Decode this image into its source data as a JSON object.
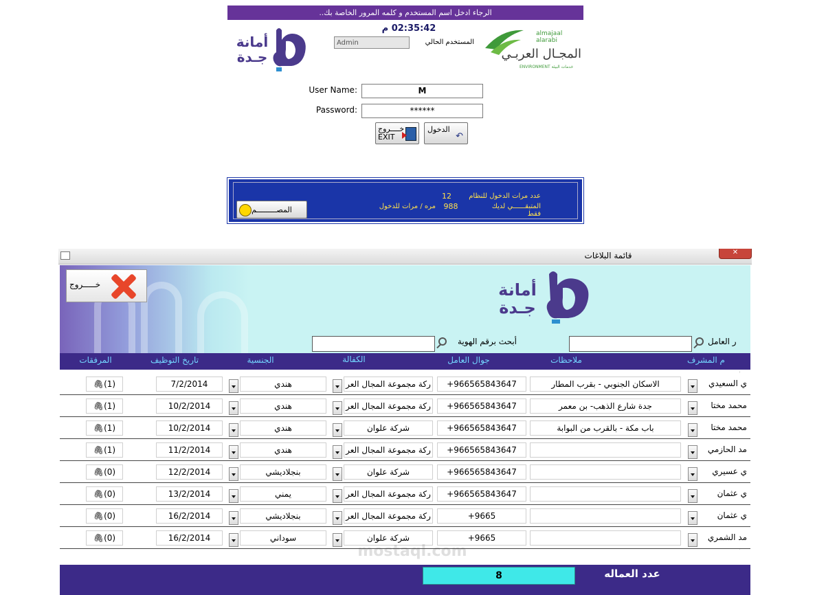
{
  "login": {
    "banner": "الرجاء ادخل اسم المستخدم و كلمه المرور  الخاصة بك..",
    "clock": "02:35:42 م",
    "current_user_label": "المستخدم الحالي",
    "current_user_value": "Admin",
    "username_label": "User Name:",
    "username_value": "M",
    "password_label": "Password:",
    "password_value": "******",
    "exit_line1": "خــــروج",
    "exit_line2": "EXIT",
    "login_label": "الدخول"
  },
  "logos": {
    "amana_line1": "أمانة",
    "amana_line2": "جـدة",
    "majal_latin": "almajaal alarabi",
    "majal_arabic": "المجـال العربـي",
    "majal_sub": "ENVIRONMENT  خدمات البيئة"
  },
  "stats": {
    "logins_label": "عدد مرات الدخول للنظام",
    "logins_value": "12",
    "remaining_label": "المتبقــــــي لديك فقط",
    "remaining_value": "988",
    "remaining_suffix": "مره / مرات للدخول",
    "ok_label": "المصـــــــــم"
  },
  "reports_window": {
    "title": "قائمة البلاغات",
    "close_button": "خـــــروج",
    "search_worker_label": "ر العامل",
    "search_id_label": "أبحث برقم الهوية",
    "search_worker_value": "",
    "search_id_value": "",
    "columns": [
      "م المشرف",
      "ملاحظات",
      "جوال العامل",
      "الكفالة",
      "الجنسية",
      "تاريخ التوظيف",
      "المرفقات"
    ],
    "rows": [
      {
        "supervisor": "ي السعيدي",
        "notes": "الاسكان الجنوبي - بقرب المطار",
        "mobile": "+966565843647",
        "sponsor": "ركة مجموعة المجال العر",
        "nationality": "هندي",
        "hire_date": "7/2/2014",
        "attachments": "(1)"
      },
      {
        "supervisor": "محمد مختا",
        "notes": "جدة شارع الذهب- بن معمر",
        "mobile": "+966565843647",
        "sponsor": "ركة مجموعة المجال العر",
        "nationality": "هندي",
        "hire_date": "10/2/2014",
        "attachments": "(1)"
      },
      {
        "supervisor": "محمد مختا",
        "notes": "باب مكة - بالقرب من البوابة",
        "mobile": "+966565843647",
        "sponsor": "شركة علوان",
        "nationality": "هندي",
        "hire_date": "10/2/2014",
        "attachments": "(1)"
      },
      {
        "supervisor": "مد الحازمي",
        "notes": "",
        "mobile": "+966565843647",
        "sponsor": "ركة مجموعة المجال العر",
        "nationality": "هندي",
        "hire_date": "11/2/2014",
        "attachments": "(1)"
      },
      {
        "supervisor": "ي عسيري",
        "notes": "",
        "mobile": "+966565843647",
        "sponsor": "شركة علوان",
        "nationality": "بنجلاديشي",
        "hire_date": "12/2/2014",
        "attachments": "(0)"
      },
      {
        "supervisor": "ي عثمان",
        "notes": "",
        "mobile": "+966565843647",
        "sponsor": "ركة مجموعة المجال العر",
        "nationality": "يمني",
        "hire_date": "13/2/2014",
        "attachments": "(0)"
      },
      {
        "supervisor": "ي عثمان",
        "notes": "",
        "mobile": "+9665",
        "sponsor": "ركة مجموعة المجال العر",
        "nationality": "بنجلاديشي",
        "hire_date": "16/2/2014",
        "attachments": "(0)"
      },
      {
        "supervisor": "مد الشمري",
        "notes": "",
        "mobile": "+9665",
        "sponsor": "شركة علوان",
        "nationality": "سوداني",
        "hire_date": "16/2/2014",
        "attachments": "(0)"
      }
    ],
    "count_label": "عدد العماله",
    "count_value": "8",
    "watermark": "mostaql.com"
  },
  "colors": {
    "banner": "#663399",
    "stats_panel": "#1a35a8",
    "stats_text": "#ffe14d",
    "header_bg": "#c9f3f3",
    "table_header": "#3c2a88",
    "column_text": "#73d5ff",
    "count_box": "#3fe8e8"
  }
}
